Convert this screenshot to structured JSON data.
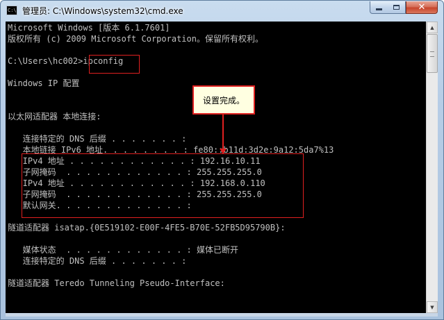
{
  "window": {
    "title": "管理员: C:\\Windows\\system32\\cmd.exe",
    "icon_text": "C:\\",
    "controls": {
      "minimize": "minimize-icon",
      "maximize": "maximize-icon",
      "close": "✕"
    }
  },
  "console": {
    "lines": [
      "Microsoft Windows [版本 6.1.7601]",
      "版权所有 (c) 2009 Microsoft Corporation。保留所有权利。",
      "",
      "C:\\Users\\hc002>ipconfig",
      "",
      "Windows IP 配置",
      "",
      "",
      "以太网适配器 本地连接:",
      "",
      "   连接特定的 DNS 后缀 . . . . . . . :",
      "   本地链接 IPv6 地址. . . . . . . . : fe80::b11d:3d2e:9a12:5da7%13",
      "   IPv4 地址 . . . . . . . . . . . . : 192.16.10.11",
      "   子网掩码  . . . . . . . . . . . . : 255.255.255.0",
      "   IPv4 地址 . . . . . . . . . . . . : 192.168.0.110",
      "   子网掩码  . . . . . . . . . . . . : 255.255.255.0",
      "   默认网关. . . . . . . . . . . . . :",
      "",
      "隧道适配器 isatap.{0E519102-E00F-4FE5-B70E-52FB5D95790B}:",
      "",
      "   媒体状态  . . . . . . . . . . . . : 媒体已断开",
      "   连接特定的 DNS 后缀 . . . . . . . :",
      "",
      "隧道适配器 Teredo Tunneling Pseudo-Interface:",
      "",
      ""
    ]
  },
  "annotation": {
    "callout_text": "设置完成。"
  },
  "scrollbar": {
    "up": "▲",
    "down": "▼"
  },
  "colors": {
    "console_bg": "#000000",
    "console_text": "#c0c0c0",
    "annotation_red": "#e02020",
    "callout_bg": "#ffffe1"
  }
}
